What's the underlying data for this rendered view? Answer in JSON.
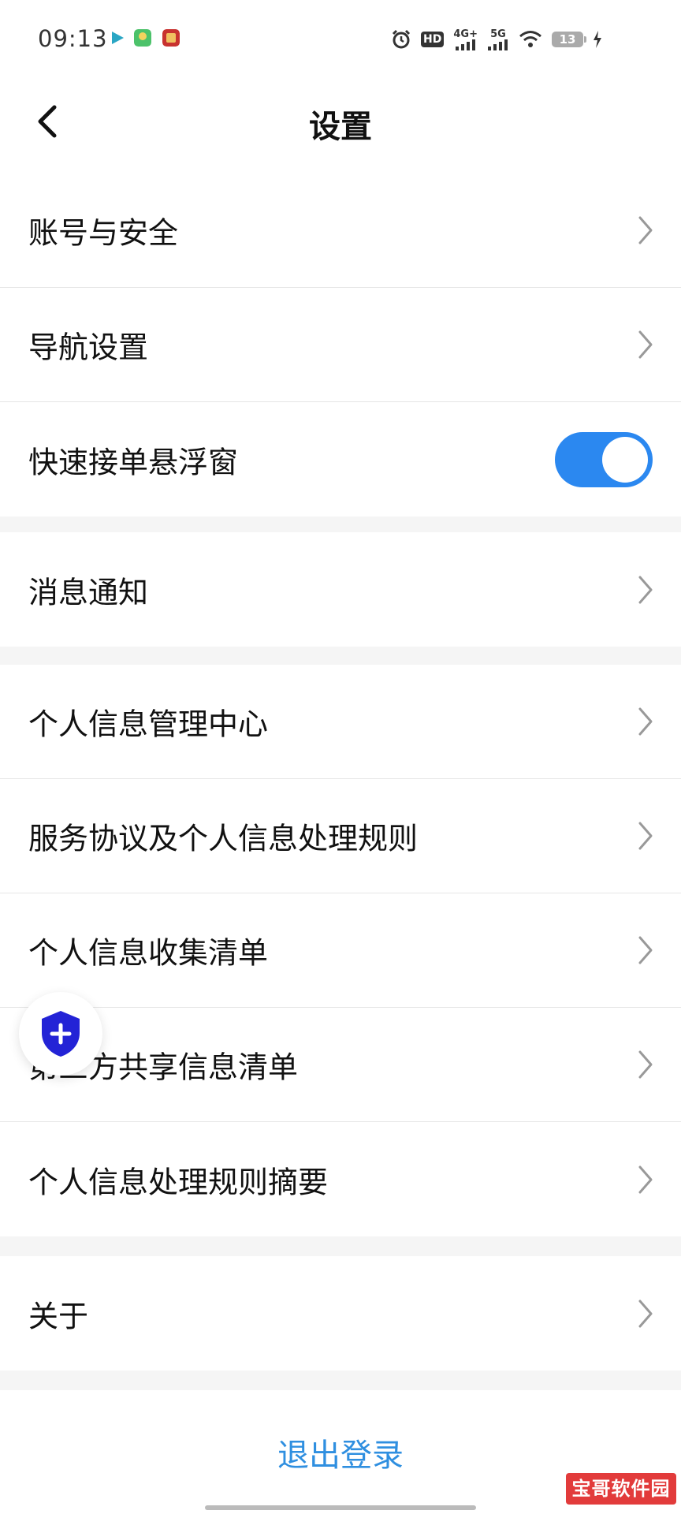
{
  "status_bar": {
    "time": "09:13",
    "hd_label": "HD",
    "sim1_network": "4G+",
    "sim2_network": "5G",
    "battery_level": "13",
    "icons": [
      "play-icon",
      "app-icon",
      "app-icon",
      "alarm-icon",
      "signal-icon",
      "wifi-icon",
      "battery-icon",
      "charging-icon"
    ]
  },
  "header": {
    "title": "设置",
    "back_icon": "back-chevron-icon"
  },
  "groups": [
    {
      "items": [
        {
          "label": "账号与安全",
          "control": "chevron"
        },
        {
          "label": "导航设置",
          "control": "chevron"
        },
        {
          "label": "快速接单悬浮窗",
          "control": "toggle",
          "toggle_on": true
        }
      ]
    },
    {
      "items": [
        {
          "label": "消息通知",
          "control": "chevron"
        }
      ]
    },
    {
      "items": [
        {
          "label": "个人信息管理中心",
          "control": "chevron"
        },
        {
          "label": "服务协议及个人信息处理规则",
          "control": "chevron"
        },
        {
          "label": "个人信息收集清单",
          "control": "chevron"
        },
        {
          "label": "第三方共享信息清单",
          "control": "chevron"
        },
        {
          "label": "个人信息处理规则摘要",
          "control": "chevron"
        }
      ]
    },
    {
      "items": [
        {
          "label": "关于",
          "control": "chevron"
        }
      ]
    }
  ],
  "logout": {
    "label": "退出登录"
  },
  "floating_button": {
    "icon": "shield-plus-icon"
  },
  "watermark": {
    "text": "宝哥软件园"
  },
  "colors": {
    "accent": "#2b88f0",
    "logout_text": "#2f8fe0",
    "shield": "#2323d6",
    "background": "#f5f5f5",
    "divider": "#e6e6e6"
  }
}
